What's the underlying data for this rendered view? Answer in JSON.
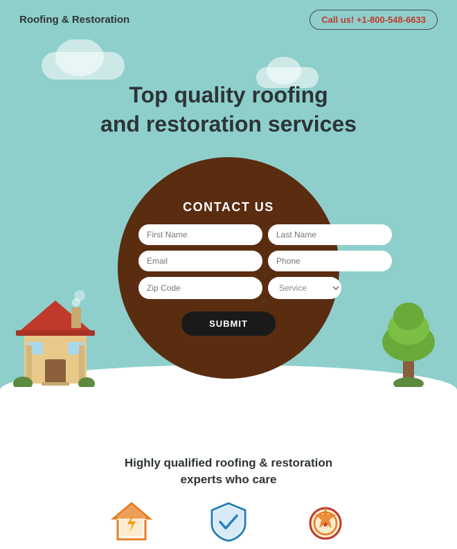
{
  "header": {
    "logo": "Roofing & Restoration",
    "call_label": "Call us!",
    "phone": "+1-800-548-6633"
  },
  "hero": {
    "title_line1": "Top quality roofing",
    "title_line2": "and restoration services"
  },
  "form": {
    "title": "CONTACT US",
    "fields": {
      "first_name_placeholder": "First Name",
      "last_name_placeholder": "Last Name",
      "email_placeholder": "Email",
      "phone_placeholder": "Phone",
      "zip_placeholder": "Zip Code",
      "service_placeholder": "Service"
    },
    "submit_label": "SUBMIT"
  },
  "bottom": {
    "title": "Highly qualified roofing & restoration",
    "subtitle": "experts who care"
  },
  "icons": [
    {
      "name": "house-lightning-icon",
      "label": "House Lightning"
    },
    {
      "name": "shield-check-icon",
      "label": "Shield Check"
    },
    {
      "name": "medal-icon",
      "label": "Medal"
    }
  ]
}
